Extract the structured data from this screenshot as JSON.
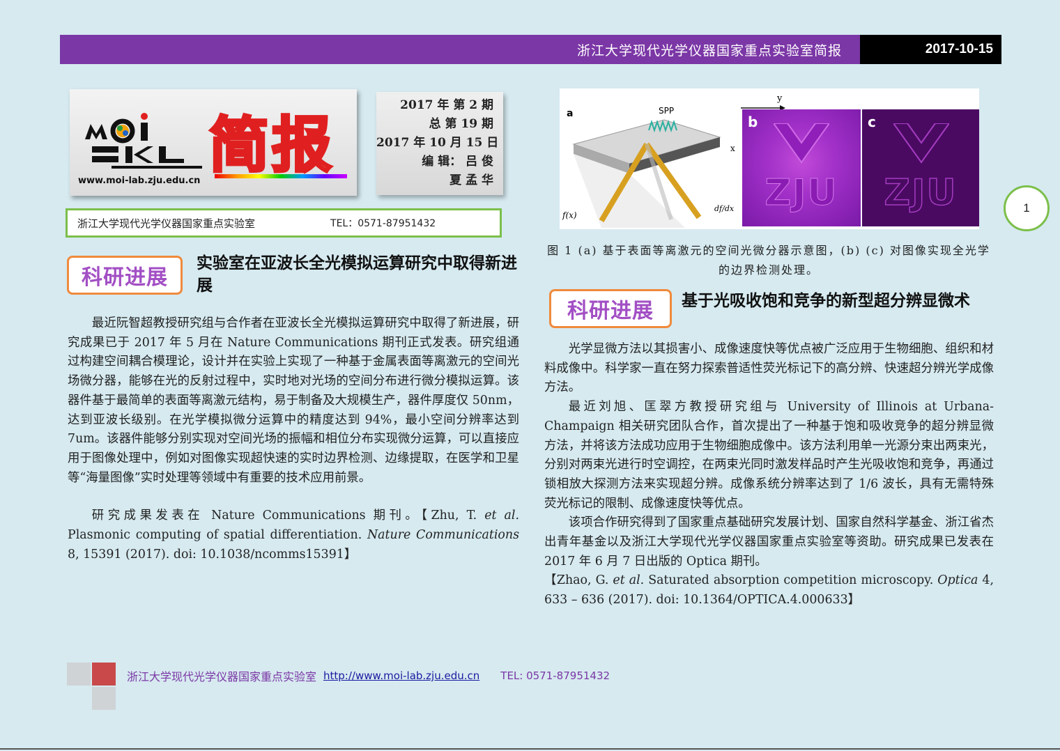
{
  "header": {
    "title": "浙江大学现代光学仪器国家重点实验室简报",
    "date": "2017-10-15"
  },
  "masthead": {
    "logo_text": "简报",
    "url": "www.moi-lab.zju.edu.cn"
  },
  "issue": {
    "line1": "2017 年 第 2 期",
    "line2": "总 第 19 期",
    "line3": "2017 年 10 月 15 日",
    "line4": "编 辑： 吕    俊",
    "line5": "夏 孟 华"
  },
  "contact": {
    "lab": "浙江大学现代光学仪器国家重点实验室",
    "tel": "TEL：0571-87951432"
  },
  "article1": {
    "tag": "科研进展",
    "title": "实验室在亚波长全光模拟运算研究中取得新进展",
    "para1": "最近阮智超教授研究组与合作者在亚波长全光模拟运算研究中取得了新进展，研究成果已于 2017 年 5 月在 Nature Communications 期刊正式发表。研究组通过构建空间耦合模理论，设计并在实验上实现了一种基于金属表面等离激元的空间光场微分器，能够在光的反射过程中，实时地对光场的空间分布进行微分模拟运算。该器件基于最简单的表面等离激元结构，易于制备及大规模生产，器件厚度仅 50nm，达到亚波长级别。在光学模拟微分运算中的精度达到 94%，最小空间分辨率达到 7um。该器件能够分别实现对空间光场的振幅和相位分布实现微分运算，可以直接应用于图像处理中，例如对图像实现超快速的实时边界检测、边缘提取，在医学和卫星等“海量图像”实时处理等领域中有重要的技术应用前景。",
    "ref_intro": "研究成果发表在 Nature Communications 期刊。【Zhu, T. ",
    "ref_etal": "et al.",
    "ref_title": " Plasmonic computing of spatial differentiation. ",
    "ref_journal": "Nature Communications",
    "ref_tail": " 8, 15391 (2017). doi: 10.1038/ncomms15391】"
  },
  "figure": {
    "label_a": "a",
    "label_b": "b",
    "label_c": "c",
    "spp": "SPP",
    "axis_y": "y",
    "axis_x": "x",
    "fx": "f(x)",
    "dfdx": "df/dx",
    "zju": "ZJU",
    "caption": "图 1 (a) 基于表面等离激元的空间光微分器示意图，(b) (c) 对图像实现全光学的边界检测处理。"
  },
  "article2": {
    "tag": "科研进展",
    "title": "基于光吸收饱和竞争的新型超分辨显微术",
    "para1": "光学显微方法以其损害小、成像速度快等优点被广泛应用于生物细胞、组织和材料成像中。科学家一直在努力探索普适性荧光标记下的高分辨、快速超分辨光学成像方法。",
    "para2": "最近刘旭、匡翠方教授研究组与 University of Illinois at Urbana-Champaign 相关研究团队合作，首次提出了一种基于饱和吸收竞争的超分辨显微方法，并将该方法成功应用于生物细胞成像中。该方法利用单一光源分束出两束光，分别对两束光进行时空调控，在两束光同时激发样品时产生光吸收饱和竞争，再通过锁相放大探测方法来实现超分辨。成像系统分辨率达到了 1/6 波长，具有无需特殊荧光标记的限制、成像速度快等优点。",
    "para3": "该项合作研究得到了国家重点基础研究发展计划、国家自然科学基金、浙江省杰出青年基金以及浙江大学现代光学仪器国家重点实验室等资助。研究成果已发表在 2017 年 6 月 7 日出版的 Optica 期刊。",
    "ref_intro": "【Zhao, G. ",
    "ref_etal": "et al.",
    "ref_title": " Saturated absorption competition microscopy. ",
    "ref_journal": "Optica",
    "ref_tail": " 4, 633 – 636 (2017). doi: 10.1364/OPTICA.4.000633】"
  },
  "page": {
    "number": "1"
  },
  "footer": {
    "lab": "浙江大学现代光学仪器国家重点实验室",
    "url": "http://www.moi-lab.zju.edu.cn",
    "tel": "TEL: 0571-87951432"
  },
  "colors": {
    "header_purple": "#7b37a6",
    "tag_border": "#f08a3c",
    "tag_text": "#a24fc4",
    "green_border": "#7cbf4a",
    "footer_red": "#c9494a",
    "footer_gray": "#cfd3d6"
  }
}
